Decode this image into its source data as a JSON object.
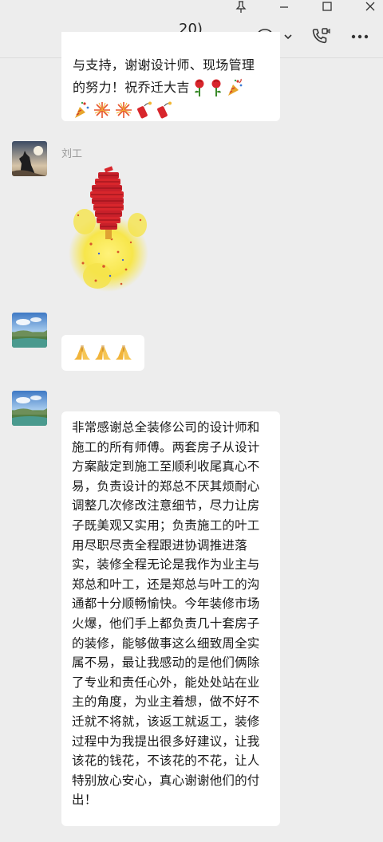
{
  "window": {
    "chat_title": "20)"
  },
  "messages": [
    {
      "lines": [
        "与支持，谢谢设计师、现场管理",
        "的努力！祝乔迁大吉"
      ]
    },
    {
      "sender": "刘工"
    },
    {
      "sender": ""
    },
    {
      "text": "非常感谢总全装修公司的设计师和施工的所有师傅。两套房子从设计方案敲定到施工至顺利收尾真心不易，负责设计的郑总不厌其烦耐心调整几次修改注意细节，尽力让房子既美观又实用；负责施工的叶工用尽职尽责全程跟进协调推进落实，装修全程无论是我作为业主与郑总和叶工，还是郑总与叶工的沟通都十分顺畅愉快。今年装修市场火爆，他们手上都负责几十套房子的装修，能够做事这么细致周全实属不易，最让我感动的是他们俩除了专业和责任心外，能处处站在业主的角度，为业主着想，做不好不迁就不将就，该返工就返工，装修过程中为我提出很多好建议，让我该花的钱花，不该花的不花，让人特别放心安心，真心谢谢他们的付出！"
    }
  ],
  "icons": {
    "pin": "pin-icon",
    "minimize": "minimize-icon",
    "maximize": "maximize-icon",
    "close": "close-icon",
    "chat_options": "chat-bubble-icon",
    "dropdown": "chevron-down-icon",
    "call": "video-call-icon",
    "more": "more-icon"
  },
  "colors": {
    "window_bg": "#ededed",
    "bubble_bg": "#ffffff",
    "text": "#1a1a1a",
    "sender_name": "#9a9a9a"
  }
}
